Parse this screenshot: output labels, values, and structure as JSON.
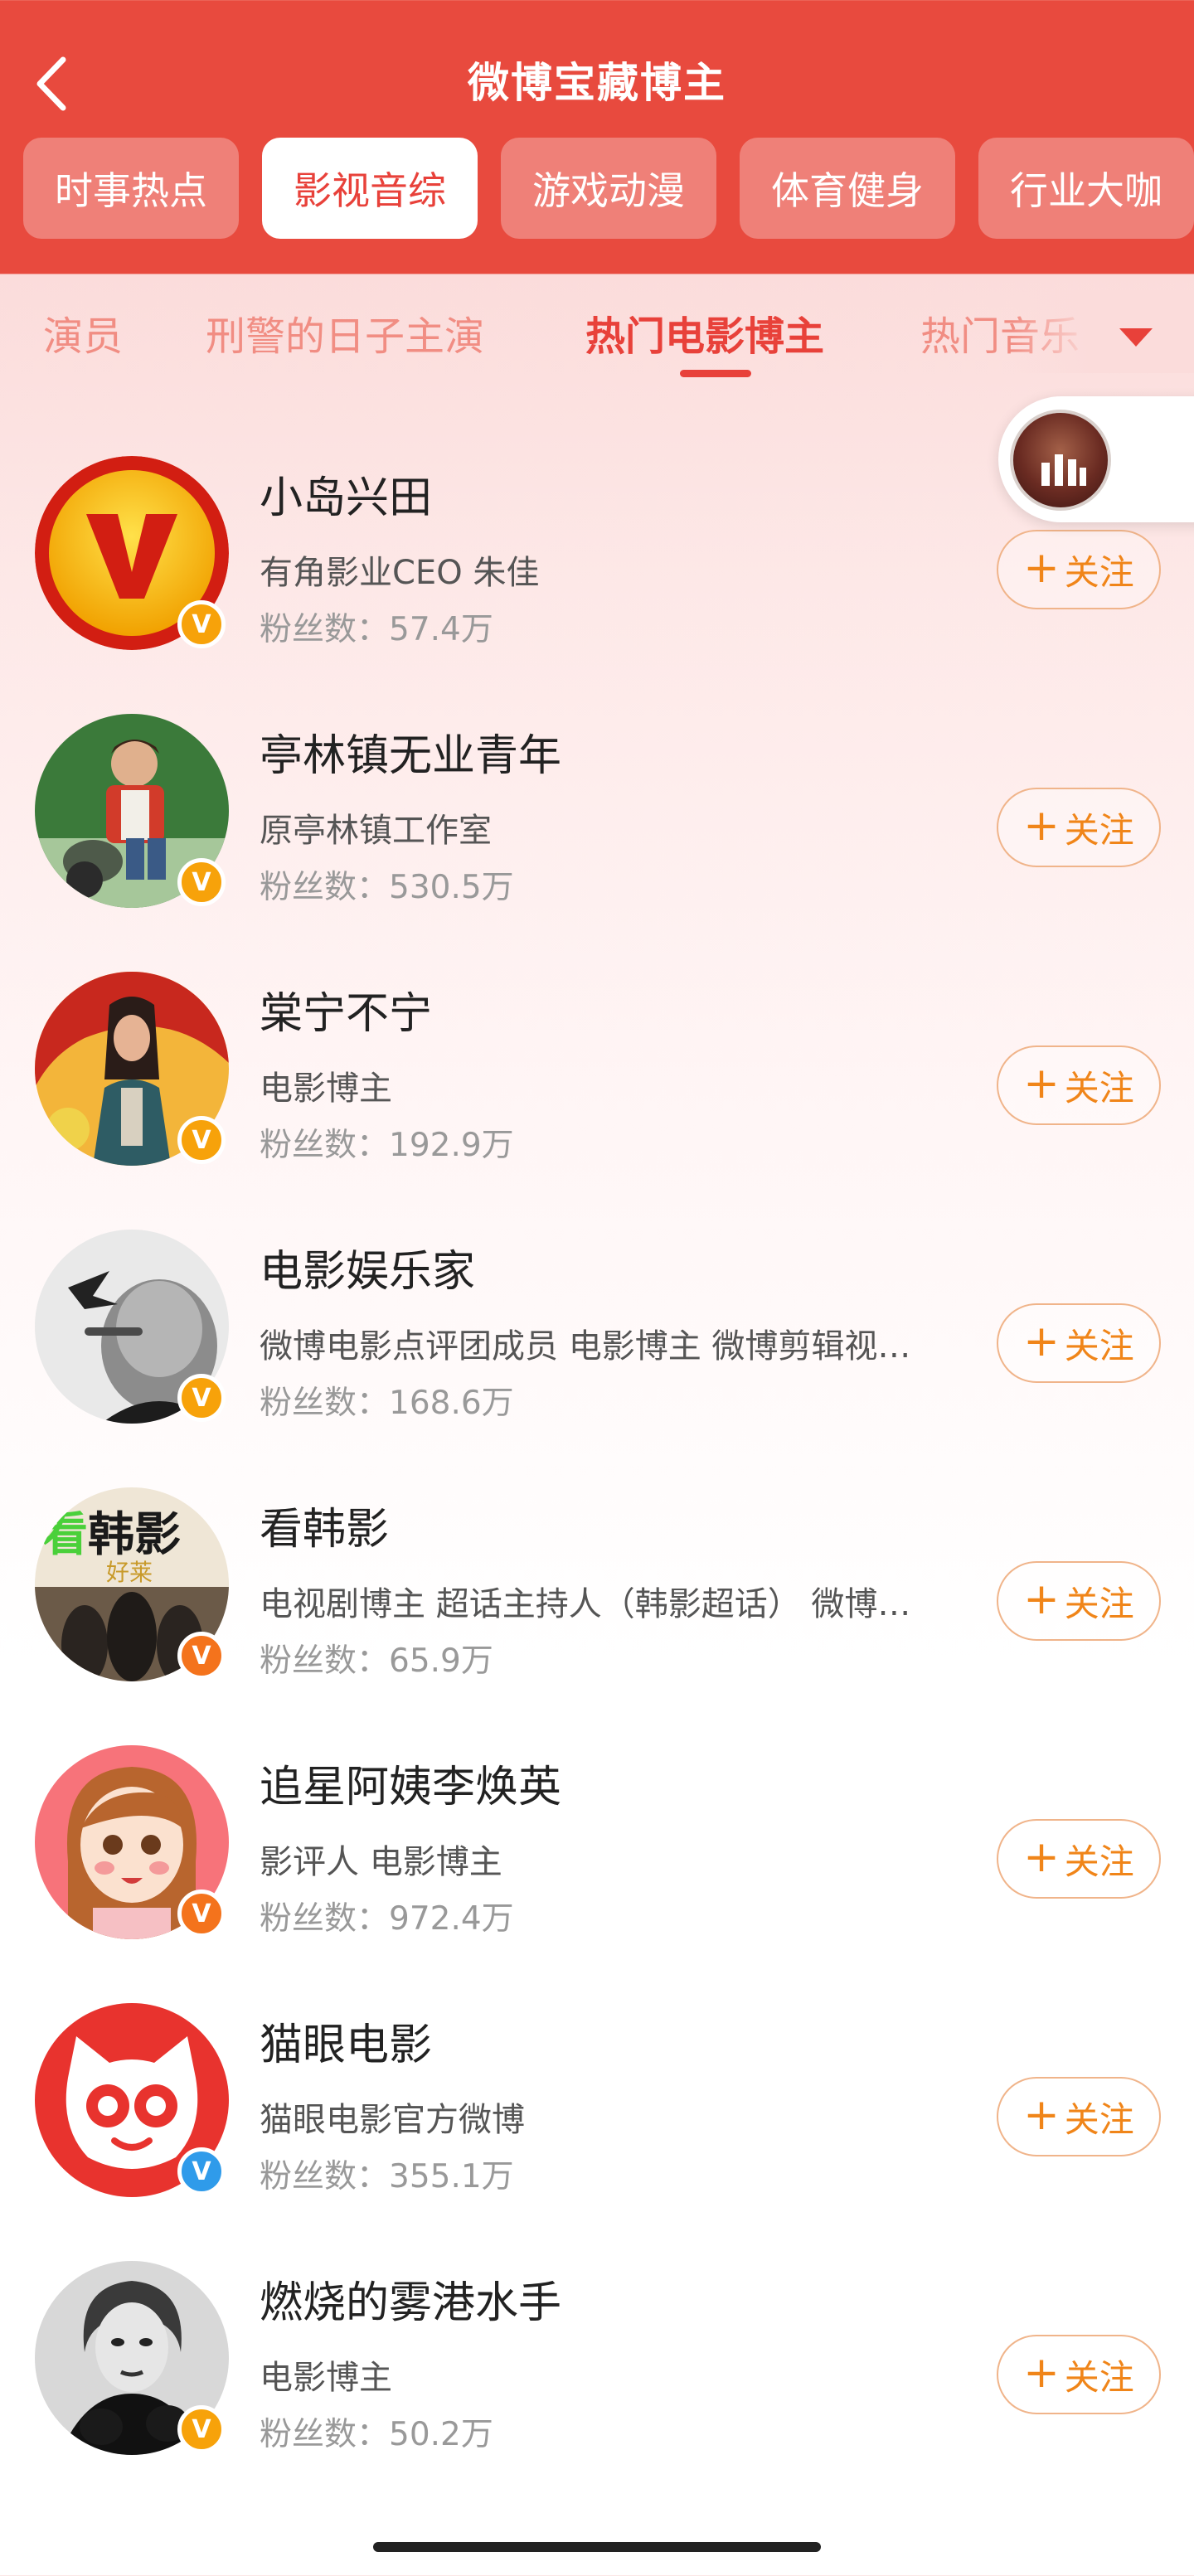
{
  "header": {
    "title": "微博宝藏博主"
  },
  "category_tabs": [
    {
      "label": "时事热点",
      "active": false
    },
    {
      "label": "影视音综",
      "active": true
    },
    {
      "label": "游戏动漫",
      "active": false
    },
    {
      "label": "体育健身",
      "active": false
    },
    {
      "label": "行业大咖",
      "active": false
    }
  ],
  "sub_tabs": [
    {
      "label": "演员",
      "active": false
    },
    {
      "label": "刑警的日子主演",
      "active": false
    },
    {
      "label": "热门电影博主",
      "active": true
    },
    {
      "label": "热门音乐",
      "active": false
    }
  ],
  "follow_label": "关注",
  "bloggers": [
    {
      "name": "小岛兴田",
      "desc": "有角影业CEO 朱佳",
      "fans": "粉丝数：57.4万",
      "badge": "V"
    },
    {
      "name": "亭林镇无业青年",
      "desc": "原亭林镇工作室",
      "fans": "粉丝数：530.5万",
      "badge": "V"
    },
    {
      "name": "棠宁不宁",
      "desc": "电影博主",
      "fans": "粉丝数：192.9万",
      "badge": "V"
    },
    {
      "name": "电影娱乐家",
      "desc": "微博电影点评团成员 电影博主 微博剪辑视…",
      "fans": "粉丝数：168.6万",
      "badge": "V"
    },
    {
      "name": "看韩影",
      "desc": "电视剧博主 超话主持人（韩影超话） 微博…",
      "fans": "粉丝数：65.9万",
      "badge": "V",
      "avatar_text": {
        "kan": "看",
        "hanying": "韩影",
        "haolaiwu": "好莱"
      }
    },
    {
      "name": "追星阿姨李焕英",
      "desc": "影评人 电影博主",
      "fans": "粉丝数：972.4万",
      "badge": "V"
    },
    {
      "name": "猫眼电影",
      "desc": "猫眼电影官方微博",
      "fans": "粉丝数：355.1万",
      "badge": "V"
    },
    {
      "name": "燃烧的雾港水手",
      "desc": "电影博主",
      "fans": "粉丝数：50.2万",
      "badge": "V"
    }
  ],
  "colors": {
    "brand_red": "#e8413a",
    "follow_orange": "#f08519",
    "verified_gold": "#f7a20a",
    "verified_blue": "#2f9bea"
  }
}
